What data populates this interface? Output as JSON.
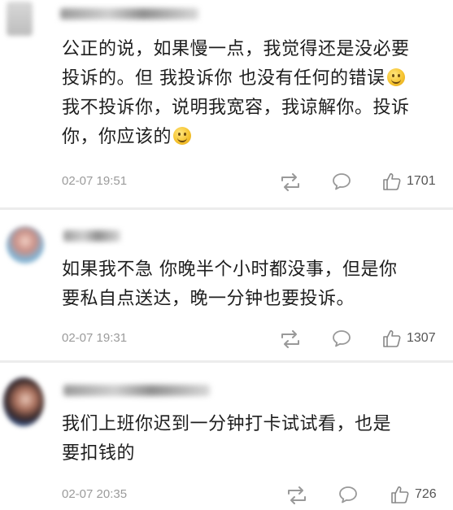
{
  "comments": [
    {
      "text_lines": [
        "公正的说，如果慢一点，我觉得还是没必要",
        "投诉的。但 我投诉你 也没有任何的错误",
        "我不投诉你，说明我宽容，我谅解你。投诉",
        "你，你应该的"
      ],
      "time": "02-07 19:51",
      "likes": "1701"
    },
    {
      "text_lines": [
        "如果我不急 你晚半个小时都没事，但是你",
        "要私自点送达，晚一分钟也要投诉。"
      ],
      "time": "02-07 19:31",
      "likes": "1307"
    },
    {
      "text_lines": [
        "我们上班你迟到一分钟打卡试试看，也是",
        "要扣钱的"
      ],
      "time": "02-07 20:35",
      "likes": "726"
    }
  ],
  "icons": {
    "repost": "repost-icon",
    "reply": "comment-bubble-icon",
    "like": "thumbs-up-icon",
    "emoji": "smile-emoji-icon"
  }
}
